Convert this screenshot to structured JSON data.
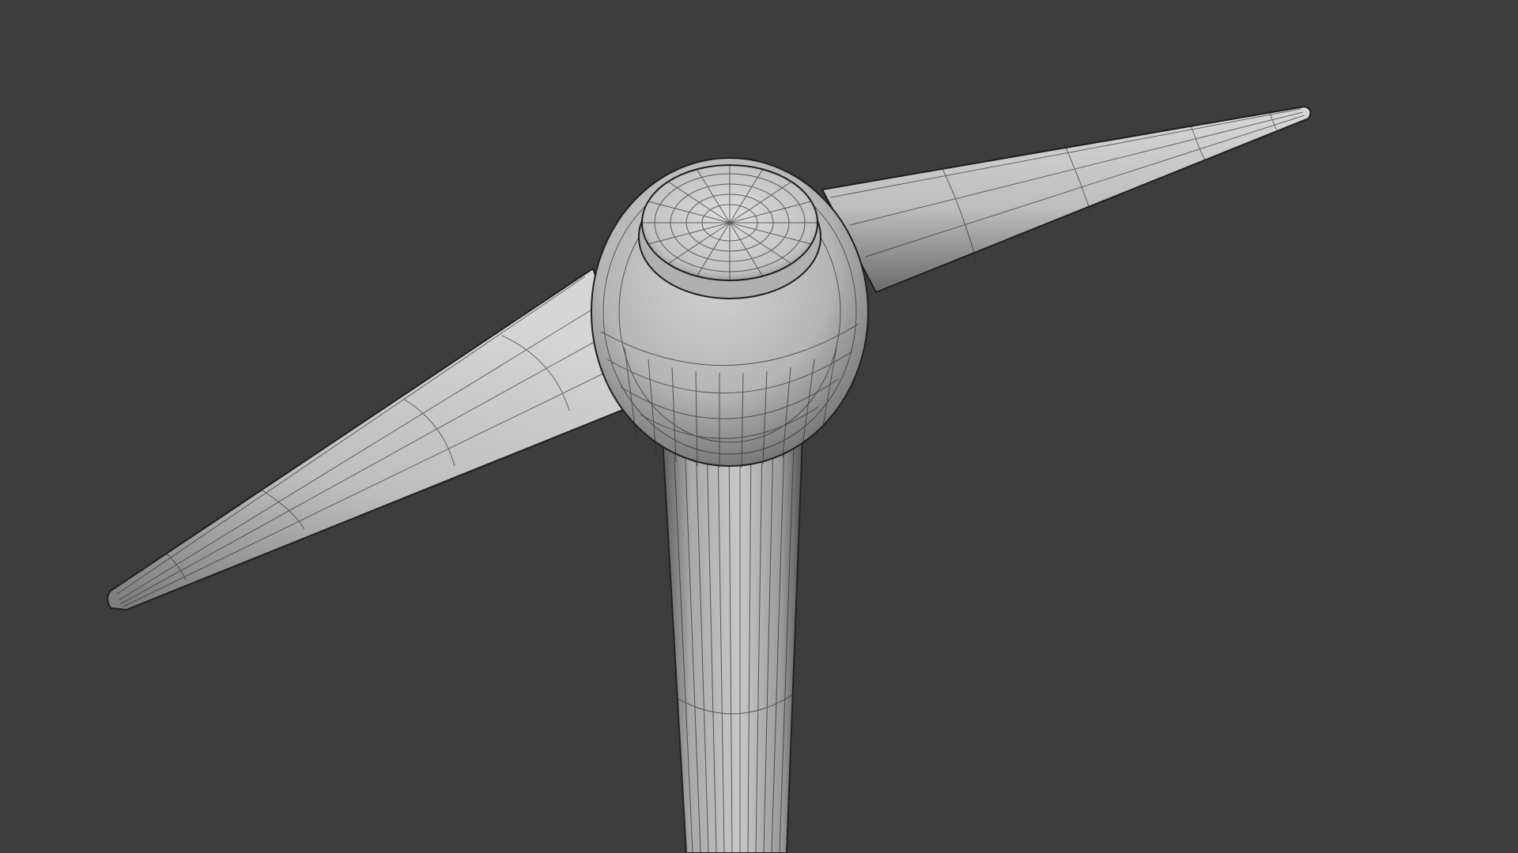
{
  "viewport": {
    "background_color": "#3d3d3d",
    "view_mode": "solid-shaded-wireframe"
  },
  "scene": {
    "object_type": "pickaxe",
    "parts": [
      "left-blade",
      "right-blade",
      "head-hub",
      "hub-cap",
      "handle"
    ],
    "colors": {
      "surface_light": "#cfcfcf",
      "surface_mid": "#a8a8a8",
      "surface_dark": "#6e6e6e",
      "wire": "#1e1e1e"
    }
  }
}
